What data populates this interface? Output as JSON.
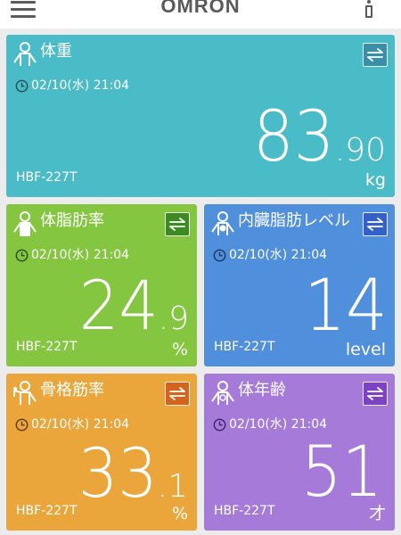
{
  "header": {
    "brand": "OMRON"
  },
  "cards": [
    {
      "title": "体重",
      "datetime": "02/10(水) 21:04",
      "value_int": "83",
      "value_dec": ".90",
      "unit": "kg",
      "device": "HBF-227T",
      "color": "#49bcc8",
      "icon": "person-icon",
      "swap_color": "#3a8fa6"
    },
    {
      "title": "体脂肪率",
      "datetime": "02/10(水) 21:04",
      "value_int": "24",
      "value_dec": ".9",
      "unit": "%",
      "device": "HBF-227T",
      "color": "#84c63f",
      "icon": "person-fat-icon",
      "swap_color": "#3d8a22"
    },
    {
      "title": "内臓脂肪レベル",
      "datetime": "02/10(水) 21:04",
      "value_int": "14",
      "value_dec": "",
      "unit": "level",
      "device": "HBF-227T",
      "color": "#4f8fdc",
      "icon": "person-visceral-icon",
      "swap_color": "#3560c9"
    },
    {
      "title": "骨格筋率",
      "datetime": "02/10(水) 21:04",
      "value_int": "33",
      "value_dec": ".1",
      "unit": "%",
      "device": "HBF-227T",
      "color": "#eaa63b",
      "icon": "person-muscle-icon",
      "swap_color": "#d4631e"
    },
    {
      "title": "体年齢",
      "datetime": "02/10(水) 21:04",
      "value_int": "51",
      "value_dec": "",
      "unit": "才",
      "device": "HBF-227T",
      "color": "#a57ad9",
      "icon": "person-age-icon",
      "swap_color": "#7d42c4"
    }
  ]
}
